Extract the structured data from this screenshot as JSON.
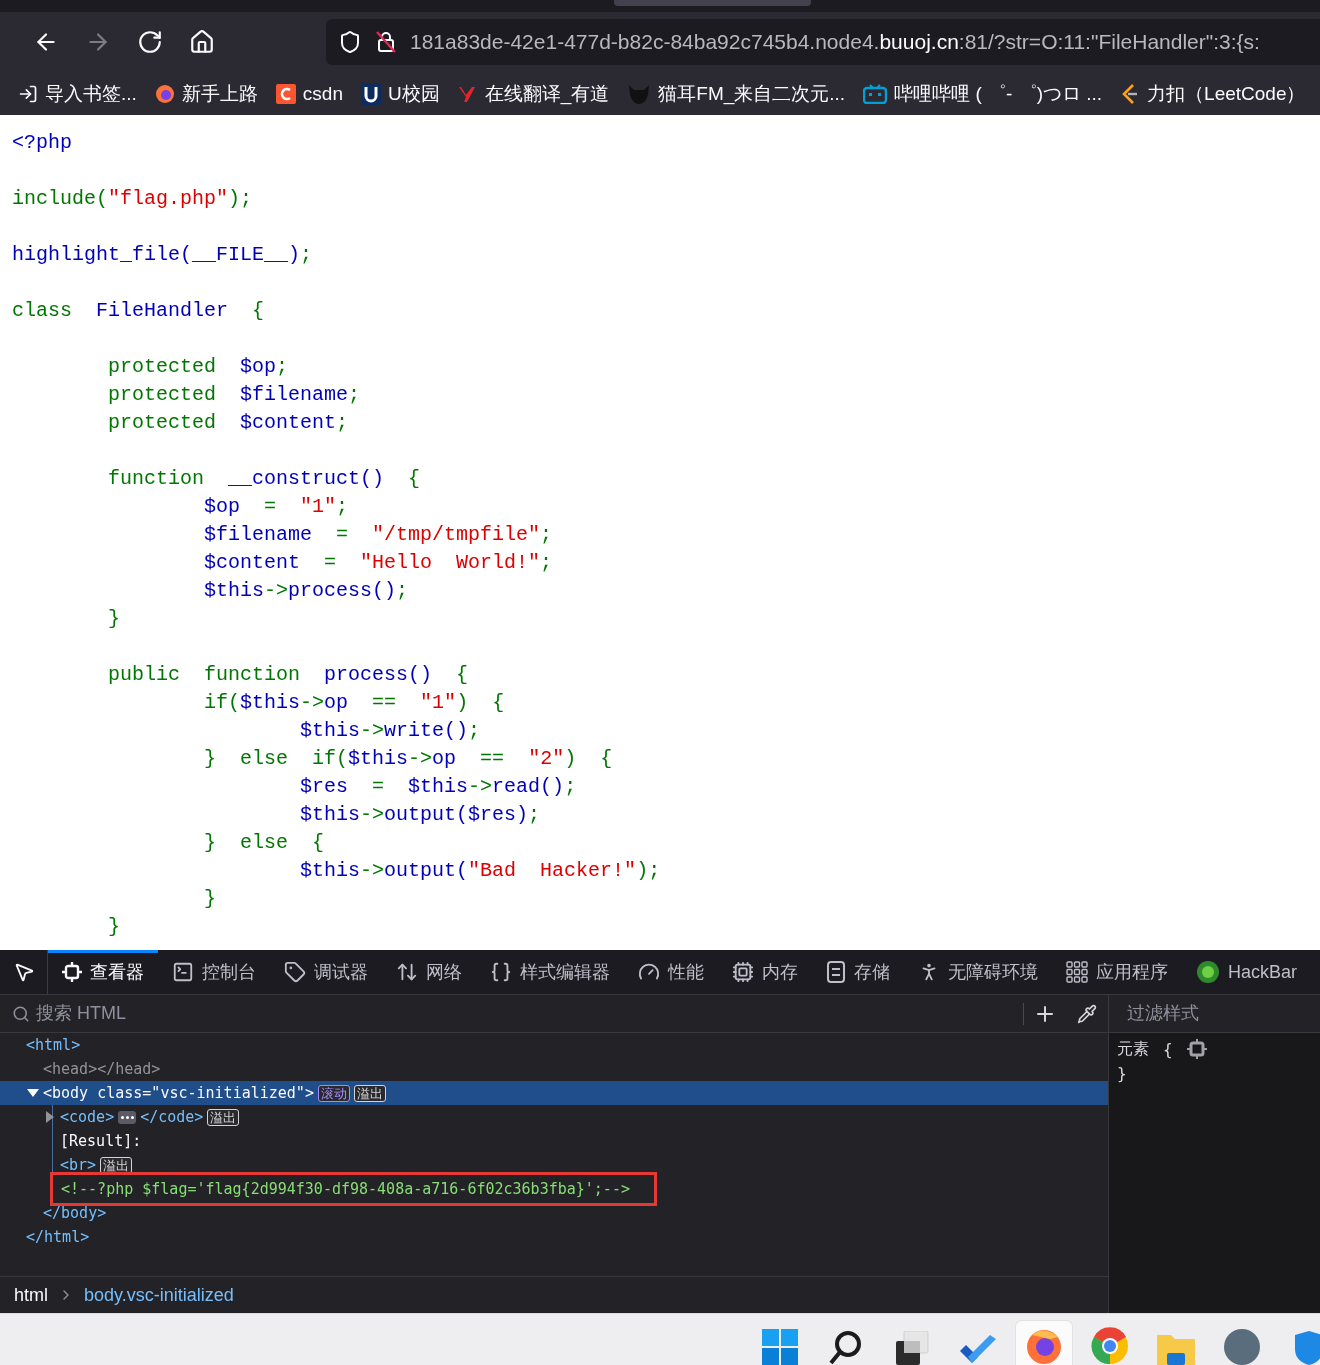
{
  "nav_buttons": [
    {
      "disabled": false
    },
    {
      "disabled": true
    },
    {
      "disabled": false
    },
    {
      "disabled": false
    }
  ],
  "address_bar": {
    "url_start": "181a83de-42e1-477d-b82c-84ba92c745b4.node4.",
    "url_domain": "buuoj.cn",
    "url_end": ":81/?str=O:11:\"FileHandler\":3:{s:"
  },
  "bookmarks": [
    {
      "label": "导入书签..."
    },
    {
      "label": "新手上路"
    },
    {
      "label": "csdn"
    },
    {
      "label": "U校园"
    },
    {
      "label": "在线翻译_有道"
    },
    {
      "label": "猫耳FM_来自二次元..."
    },
    {
      "label": "哔哩哔哩 ( ゜- ゜)つロ ..."
    },
    {
      "label": "力扣（LeetCode）"
    }
  ],
  "page": {
    "code_lines": [
      {
        "kind": "code",
        "tokens": [
          {
            "kind": "default",
            "text": "<?php"
          }
        ]
      },
      {
        "kind": "blank"
      },
      {
        "kind": "code",
        "tokens": [
          {
            "kind": "keyword",
            "text": "include("
          },
          {
            "kind": "string",
            "text": "\"flag.php\""
          },
          {
            "kind": "keyword",
            "text": ");"
          }
        ]
      },
      {
        "kind": "blank"
      },
      {
        "kind": "code",
        "tokens": [
          {
            "kind": "default",
            "text": "highlight_file(__FILE__)"
          },
          {
            "kind": "keyword",
            "text": ";"
          }
        ]
      },
      {
        "kind": "blank"
      },
      {
        "kind": "code",
        "tokens": [
          {
            "kind": "keyword",
            "text": "class  "
          },
          {
            "kind": "default",
            "text": "FileHandler  "
          },
          {
            "kind": "keyword",
            "text": "{"
          }
        ]
      },
      {
        "kind": "blank"
      },
      {
        "kind": "code",
        "tokens": [
          {
            "kind": "keyword",
            "text": "        protected  "
          },
          {
            "kind": "default",
            "text": "$op"
          },
          {
            "kind": "keyword",
            "text": ";"
          }
        ]
      },
      {
        "kind": "code",
        "tokens": [
          {
            "kind": "keyword",
            "text": "        protected  "
          },
          {
            "kind": "default",
            "text": "$filename"
          },
          {
            "kind": "keyword",
            "text": ";"
          }
        ]
      },
      {
        "kind": "code",
        "tokens": [
          {
            "kind": "keyword",
            "text": "        protected  "
          },
          {
            "kind": "default",
            "text": "$content"
          },
          {
            "kind": "keyword",
            "text": ";"
          }
        ]
      },
      {
        "kind": "blank"
      },
      {
        "kind": "code",
        "tokens": [
          {
            "kind": "keyword",
            "text": "        function  "
          },
          {
            "kind": "default",
            "text": "__construct()"
          },
          {
            "kind": "keyword",
            "text": "  {"
          }
        ]
      },
      {
        "kind": "code",
        "tokens": [
          {
            "kind": "default",
            "text": "                $op"
          },
          {
            "kind": "keyword",
            "text": "  =  "
          },
          {
            "kind": "string",
            "text": "\"1\""
          },
          {
            "kind": "keyword",
            "text": ";"
          }
        ]
      },
      {
        "kind": "code",
        "tokens": [
          {
            "kind": "default",
            "text": "                $filename"
          },
          {
            "kind": "keyword",
            "text": "  =  "
          },
          {
            "kind": "string",
            "text": "\"/tmp/tmpfile\""
          },
          {
            "kind": "keyword",
            "text": ";"
          }
        ]
      },
      {
        "kind": "code",
        "tokens": [
          {
            "kind": "default",
            "text": "                $content"
          },
          {
            "kind": "keyword",
            "text": "  =  "
          },
          {
            "kind": "string",
            "text": "\"Hello  World!\""
          },
          {
            "kind": "keyword",
            "text": ";"
          }
        ]
      },
      {
        "kind": "code",
        "tokens": [
          {
            "kind": "default",
            "text": "                $this"
          },
          {
            "kind": "keyword",
            "text": "->"
          },
          {
            "kind": "default",
            "text": "process()"
          },
          {
            "kind": "keyword",
            "text": ";"
          }
        ]
      },
      {
        "kind": "code",
        "tokens": [
          {
            "kind": "keyword",
            "text": "        }"
          }
        ]
      },
      {
        "kind": "blank"
      },
      {
        "kind": "code",
        "tokens": [
          {
            "kind": "keyword",
            "text": "        public  function  "
          },
          {
            "kind": "default",
            "text": "process()"
          },
          {
            "kind": "keyword",
            "text": "  {"
          }
        ]
      },
      {
        "kind": "code",
        "tokens": [
          {
            "kind": "keyword",
            "text": "                if("
          },
          {
            "kind": "default",
            "text": "$this"
          },
          {
            "kind": "keyword",
            "text": "->"
          },
          {
            "kind": "default",
            "text": "op"
          },
          {
            "kind": "keyword",
            "text": "  ==  "
          },
          {
            "kind": "string",
            "text": "\"1\""
          },
          {
            "kind": "keyword",
            "text": ")  {"
          }
        ]
      },
      {
        "kind": "code",
        "tokens": [
          {
            "kind": "default",
            "text": "                        $this"
          },
          {
            "kind": "keyword",
            "text": "->"
          },
          {
            "kind": "default",
            "text": "write()"
          },
          {
            "kind": "keyword",
            "text": ";"
          }
        ]
      },
      {
        "kind": "code",
        "tokens": [
          {
            "kind": "keyword",
            "text": "                }  else  if("
          },
          {
            "kind": "default",
            "text": "$this"
          },
          {
            "kind": "keyword",
            "text": "->"
          },
          {
            "kind": "default",
            "text": "op"
          },
          {
            "kind": "keyword",
            "text": "  ==  "
          },
          {
            "kind": "string",
            "text": "\"2\""
          },
          {
            "kind": "keyword",
            "text": ")  {"
          }
        ]
      },
      {
        "kind": "code",
        "tokens": [
          {
            "kind": "default",
            "text": "                        $res"
          },
          {
            "kind": "keyword",
            "text": "  =  "
          },
          {
            "kind": "default",
            "text": "$this"
          },
          {
            "kind": "keyword",
            "text": "->"
          },
          {
            "kind": "default",
            "text": "read()"
          },
          {
            "kind": "keyword",
            "text": ";"
          }
        ]
      },
      {
        "kind": "code",
        "tokens": [
          {
            "kind": "default",
            "text": "                        $this"
          },
          {
            "kind": "keyword",
            "text": "->"
          },
          {
            "kind": "default",
            "text": "output($res)"
          },
          {
            "kind": "keyword",
            "text": ";"
          }
        ]
      },
      {
        "kind": "code",
        "tokens": [
          {
            "kind": "keyword",
            "text": "                }  else  {"
          }
        ]
      },
      {
        "kind": "code",
        "tokens": [
          {
            "kind": "default",
            "text": "                        $this"
          },
          {
            "kind": "keyword",
            "text": "->"
          },
          {
            "kind": "default",
            "text": "output("
          },
          {
            "kind": "string",
            "text": "\"Bad  Hacker!\""
          },
          {
            "kind": "keyword",
            "text": ");"
          }
        ]
      },
      {
        "kind": "code",
        "tokens": [
          {
            "kind": "keyword",
            "text": "                }"
          }
        ]
      },
      {
        "kind": "code",
        "tokens": [
          {
            "kind": "keyword",
            "text": "        }"
          }
        ]
      }
    ]
  },
  "devtools": {
    "tabs": [
      {
        "label": "查看器",
        "selected": true
      },
      {
        "label": "控制台",
        "selected": false
      },
      {
        "label": "调试器",
        "selected": false
      },
      {
        "label": "网络",
        "selected": false
      },
      {
        "label": "样式编辑器",
        "selected": false
      },
      {
        "label": "性能",
        "selected": false
      },
      {
        "label": "内存",
        "selected": false
      },
      {
        "label": "存储",
        "selected": false
      },
      {
        "label": "无障碍环境",
        "selected": false
      },
      {
        "label": "应用程序",
        "selected": false
      },
      {
        "label": "HackBar",
        "selected": false
      }
    ],
    "search": {
      "placeholder": "搜索 HTML"
    },
    "tree": [
      {
        "kind": "element",
        "open": "<html>",
        "close": "</html>",
        "selected": false,
        "children": [
          {
            "kind": "element",
            "open": "<head></head>",
            "dimmed": true,
            "selected": false
          },
          {
            "kind": "element",
            "open": "<body class=\"vsc-initialized\">",
            "close": "</body>",
            "expanded": true,
            "selected": true,
            "badges": [
              {
                "label": "滚动",
                "color": "#a48cf8"
              },
              {
                "label": "溢出",
                "color": "#d4d4d4"
              }
            ],
            "children": [
              {
                "kind": "element",
                "open": "<code>",
                "close": "</code>",
                "expanded": false,
                "selected": false,
                "badges": [
                  {
                    "label": "溢出",
                    "color": "#d4d4d4"
                  }
                ]
              },
              {
                "kind": "text",
                "text": "[Result]:"
              },
              {
                "kind": "element",
                "open": "<br>",
                "selected": false,
                "badges": [
                  {
                    "label": "溢出",
                    "color": "#d4d4d4"
                  }
                ]
              },
              {
                "kind": "comment",
                "text": "<!--?php $flag='flag{2d994f30-df98-408a-a716-6f02c36b3fba}';-->",
                "outlined": true
              }
            ]
          }
        ]
      }
    ],
    "breadcrumbs": [
      {
        "label": "html",
        "selected": false
      },
      {
        "label": "body.vsc-initialized",
        "selected": true
      }
    ],
    "styles": {
      "filter_placeholder": "过滤样式",
      "selector": "元素",
      "open_brace": "{",
      "close_brace": "}"
    }
  },
  "taskbar": {
    "apps": [
      {
        "selected": false
      },
      {
        "selected": false
      },
      {
        "selected": false
      },
      {
        "selected": false
      },
      {
        "selected": true
      },
      {
        "selected": false
      },
      {
        "selected": false
      },
      {
        "selected": false
      },
      {
        "selected": false
      }
    ]
  }
}
